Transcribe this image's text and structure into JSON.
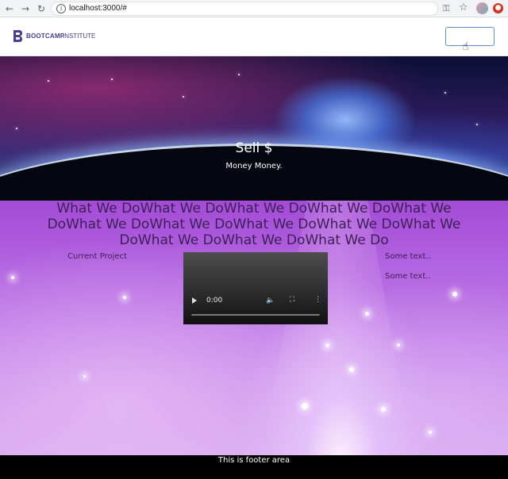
{
  "browser": {
    "url": "localhost:3000/#",
    "icons": [
      "back-icon",
      "forward-icon",
      "reload-icon",
      "info-icon",
      "key-icon",
      "star-icon",
      "profile-avatar",
      "extension-icon"
    ]
  },
  "header": {
    "logo_bold": "BOOTCAMP",
    "logo_light": "INSTITUTE",
    "button_label": ""
  },
  "hero": {
    "title": "Sell $",
    "subtitle": "Money Money."
  },
  "main": {
    "section_title": "What We DoWhat We DoWhat We DoWhat We DoWhat We DoWhat We DoWhat We DoWhat We DoWhat We DoWhat We DoWhat We DoWhat We DoWhat We Do",
    "current_project": "Current Project",
    "side_text_1": "Some text..",
    "side_text_2": "Some text..",
    "video": {
      "time": "0:00",
      "progress": 0
    }
  },
  "footer": {
    "text": "This is footer area"
  },
  "colors": {
    "brand": "#4b3d8f",
    "button_border": "#5b8fd6",
    "footer_bg": "#000000",
    "main_bg": "#b86ce3"
  }
}
